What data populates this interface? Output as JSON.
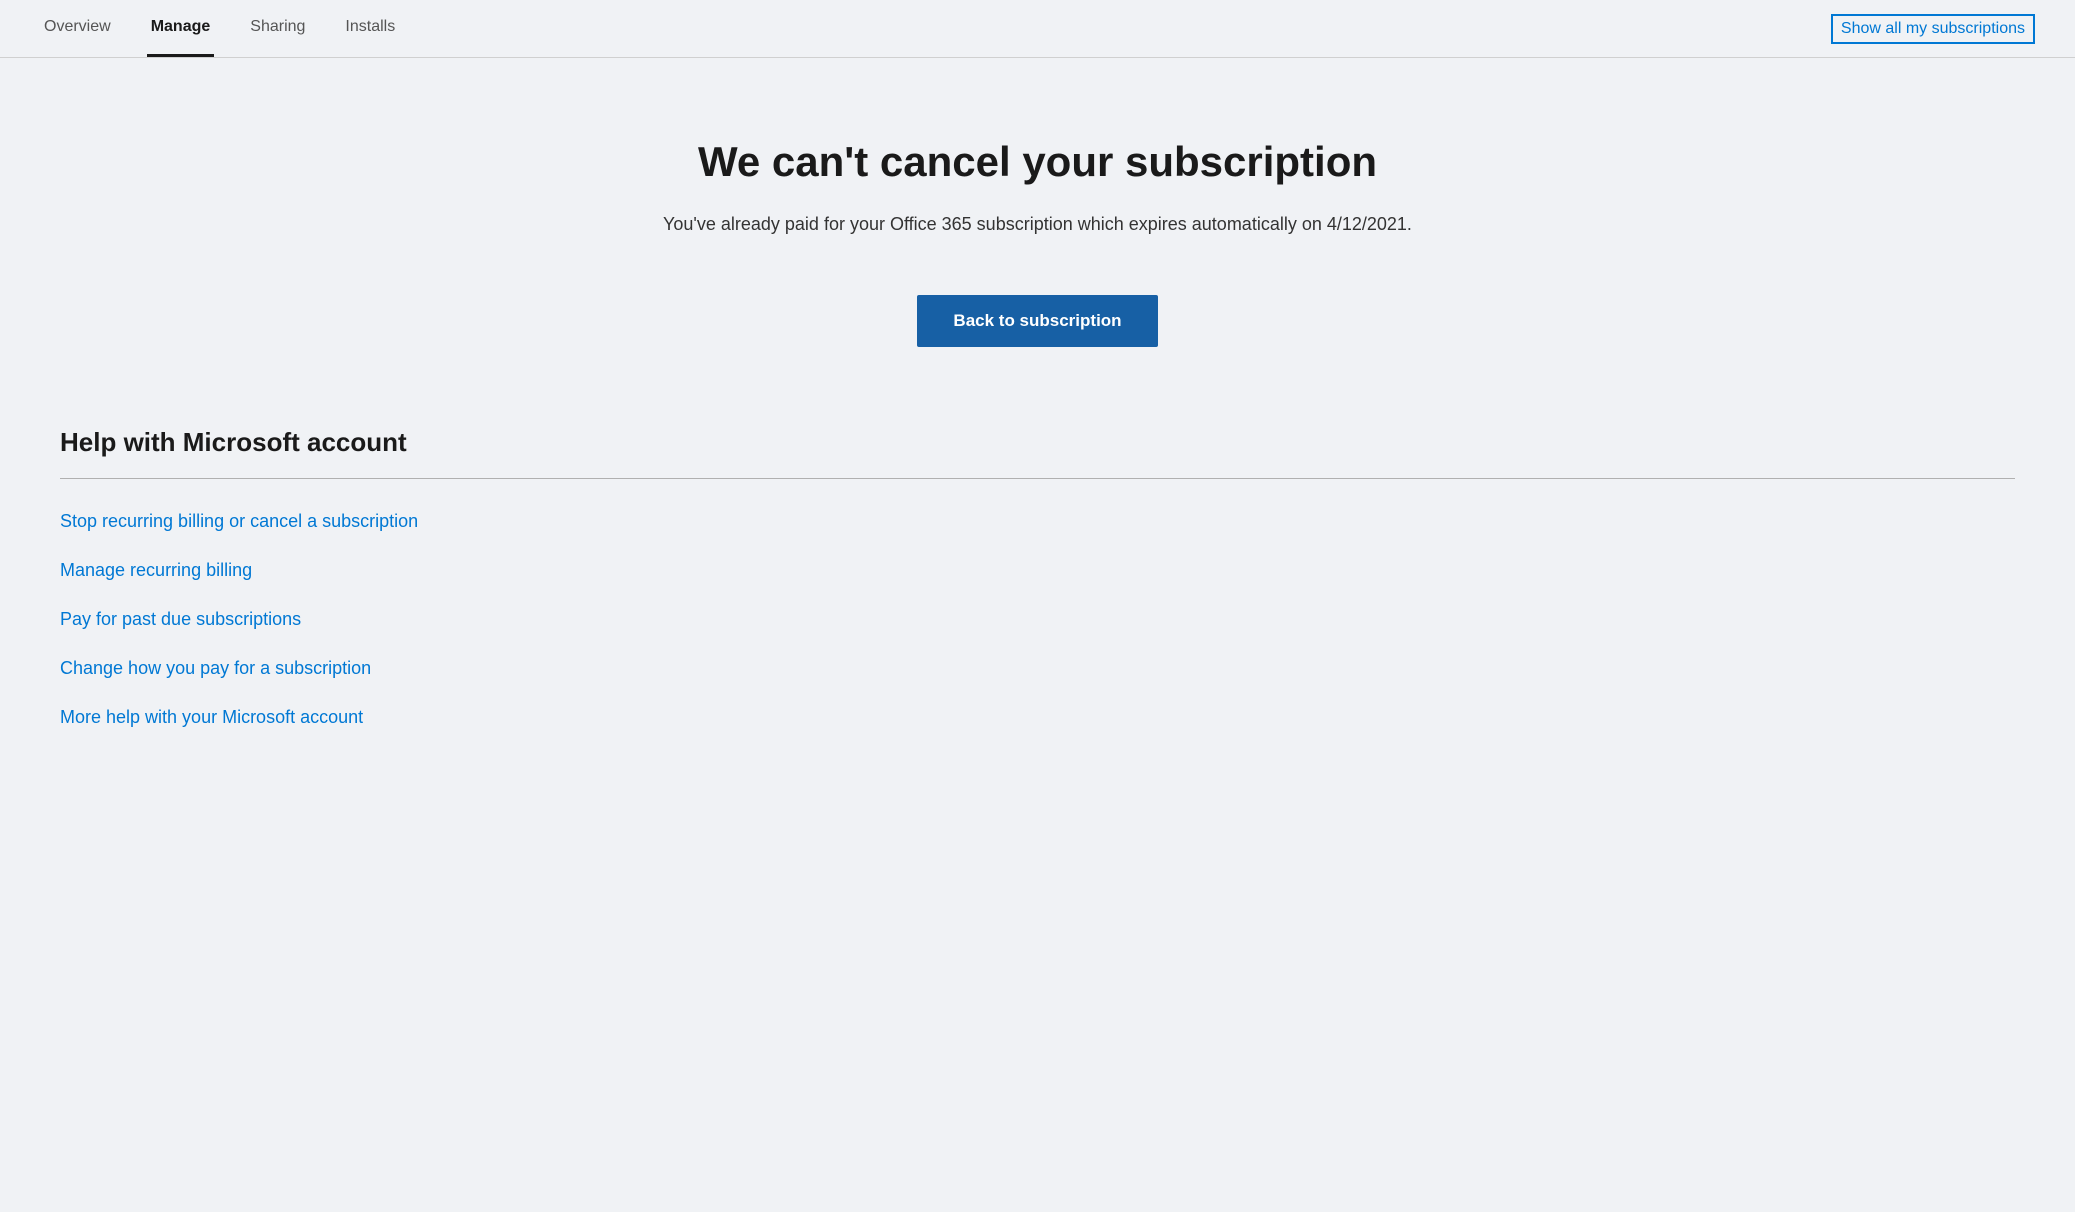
{
  "nav": {
    "tabs": [
      {
        "id": "overview",
        "label": "Overview",
        "active": false
      },
      {
        "id": "manage",
        "label": "Manage",
        "active": true
      },
      {
        "id": "sharing",
        "label": "Sharing",
        "active": false
      },
      {
        "id": "installs",
        "label": "Installs",
        "active": false
      }
    ],
    "show_all_label": "Show all my subscriptions"
  },
  "main": {
    "error_title": "We can't cancel your subscription",
    "error_description": "You've already paid for your Office 365 subscription which expires automatically on 4/12/2021.",
    "back_button_label": "Back to subscription"
  },
  "help": {
    "section_title": "Help with Microsoft account",
    "links": [
      {
        "id": "stop-recurring",
        "label": "Stop recurring billing or cancel a subscription"
      },
      {
        "id": "manage-recurring",
        "label": "Manage recurring billing"
      },
      {
        "id": "pay-past-due",
        "label": "Pay for past due subscriptions"
      },
      {
        "id": "change-payment",
        "label": "Change how you pay for a subscription"
      },
      {
        "id": "more-help",
        "label": "More help with your Microsoft account"
      }
    ]
  }
}
